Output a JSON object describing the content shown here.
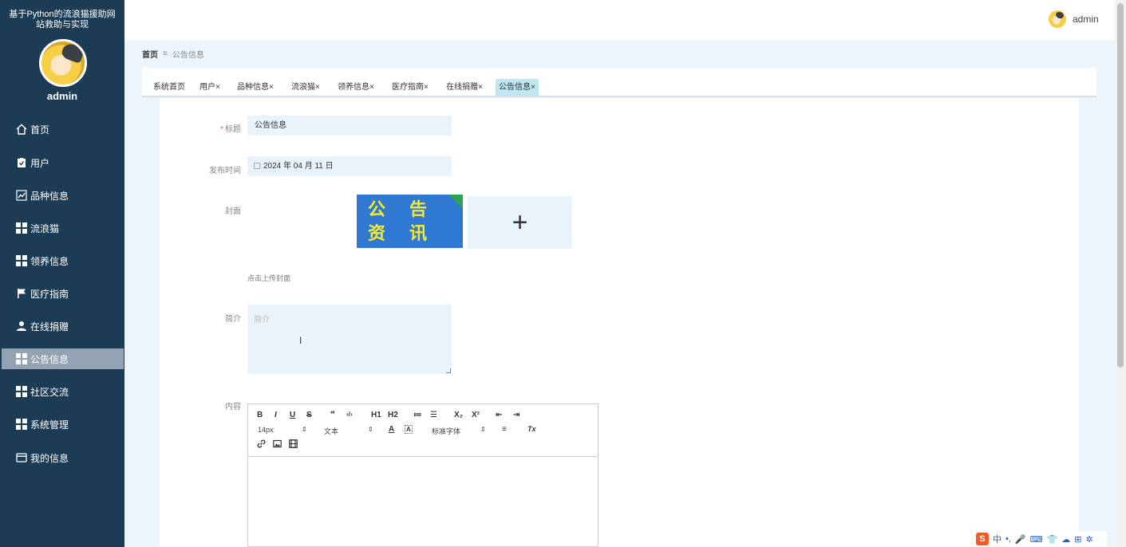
{
  "sidebar": {
    "system_title_line1": "基于Python的流浪猫援助网",
    "system_title_line2": "站救助与实现",
    "admin_name": "admin",
    "menu": [
      {
        "label": "首页",
        "icon": "home-icon"
      },
      {
        "label": "用户",
        "icon": "clipboard-icon"
      },
      {
        "label": "品种信息",
        "icon": "chart-icon"
      },
      {
        "label": "流浪猫",
        "icon": "grid-icon"
      },
      {
        "label": "领养信息",
        "icon": "grid-icon"
      },
      {
        "label": "医疗指南",
        "icon": "flag-icon"
      },
      {
        "label": "在线捐赠",
        "icon": "user-icon"
      },
      {
        "label": "公告信息",
        "icon": "grid-icon"
      },
      {
        "label": "社区交流",
        "icon": "grid-icon"
      },
      {
        "label": "系统管理",
        "icon": "grid-icon"
      },
      {
        "label": "我的信息",
        "icon": "card-icon"
      }
    ],
    "active_index": 7
  },
  "header": {
    "user": "admin"
  },
  "breadcrumb": {
    "home": "首页",
    "separator": "≡",
    "current": "公告信息"
  },
  "tabs": [
    {
      "label": "系统首页",
      "closable": false
    },
    {
      "label": "用户",
      "closable": true
    },
    {
      "label": "品种信息",
      "closable": true
    },
    {
      "label": "流浪猫",
      "closable": true
    },
    {
      "label": "领养信息",
      "closable": true
    },
    {
      "label": "医疗指南",
      "closable": true
    },
    {
      "label": "在线捐赠",
      "closable": true
    },
    {
      "label": "公告信息",
      "closable": true,
      "active": true
    }
  ],
  "tab_close": "×",
  "form": {
    "title_label": "标题",
    "required_mark": "*",
    "title_value": "公告信息",
    "date_label": "发布时间",
    "date_value": "2024 年 04 月 11 日",
    "cover_label": "封面",
    "cover_image_text": [
      "公",
      "告",
      "资",
      "讯"
    ],
    "upload_plus": "+",
    "upload_hint": "点击上传封面",
    "intro_label": "简介",
    "intro_placeholder": "简介",
    "content_label": "内容"
  },
  "editor": {
    "row1": [
      "B",
      "I",
      "U",
      "S",
      "❞",
      "‹/›",
      "H1",
      "H2",
      "≔",
      "☰",
      "X₂",
      "X²",
      "⇤",
      "⇥"
    ],
    "font_size": "14px",
    "text_type": "文本",
    "font_color": "A",
    "font_bg": "A",
    "font_family": "标准字体",
    "align": "≡",
    "clear": "Tx",
    "select_arrow": "⇕"
  },
  "ime": {
    "logo": "S",
    "lang": "中",
    "items": [
      "•,",
      "🎤",
      "⌨",
      "👕",
      "☁",
      "⊞",
      "✲"
    ]
  },
  "colors": {
    "sidebar_bg": "#1c3c55",
    "active_menu": "#93a3b3",
    "active_tab": "#bfe6f3",
    "field_bg": "#e9f3fc"
  }
}
